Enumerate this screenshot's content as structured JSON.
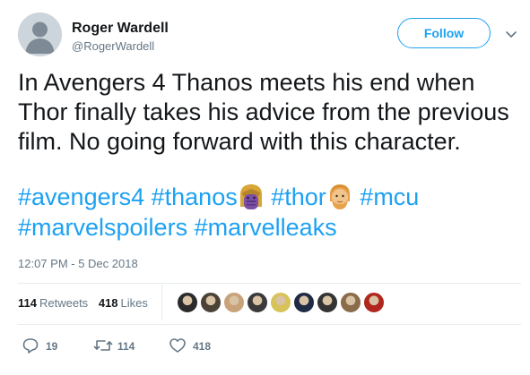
{
  "user": {
    "display_name": "Roger Wardell",
    "handle": "@RogerWardell",
    "follow_label": "Follow"
  },
  "tweet": {
    "lines": [
      "In Avengers 4 Thanos meets his end when",
      "Thor finally takes his advice from the previous",
      "film. No going forward with this character."
    ],
    "hashtags": [
      "#avengers4",
      "#thanos",
      "#thor",
      "#mcu",
      "#marvelspoilers",
      "#marvelleaks"
    ],
    "emojis": [
      "thanos-face-emoji",
      "thor-face-emoji"
    ]
  },
  "timestamp": "12:07 PM - 5 Dec 2018",
  "stats": {
    "retweets_count": "114",
    "retweets_label": "Retweets",
    "likes_count": "418",
    "likes_label": "Likes"
  },
  "likers": [
    {
      "color": "#2b2b2b"
    },
    {
      "color": "#4a4236"
    },
    {
      "color": "#c9a27a"
    },
    {
      "color": "#3a3a3a"
    },
    {
      "color": "#d8c25a"
    },
    {
      "color": "#1f2a44"
    },
    {
      "color": "#333333"
    },
    {
      "color": "#8a6b4a"
    },
    {
      "color": "#b0271e"
    }
  ],
  "actions": {
    "reply_count": "19",
    "retweet_count": "114",
    "like_count": "418"
  },
  "colors": {
    "accent": "#1da1f2",
    "muted": "#657786",
    "text": "#14171a"
  },
  "icons": [
    "default-avatar-icon",
    "chevron-down-icon",
    "reply-icon",
    "retweet-icon",
    "heart-icon"
  ]
}
